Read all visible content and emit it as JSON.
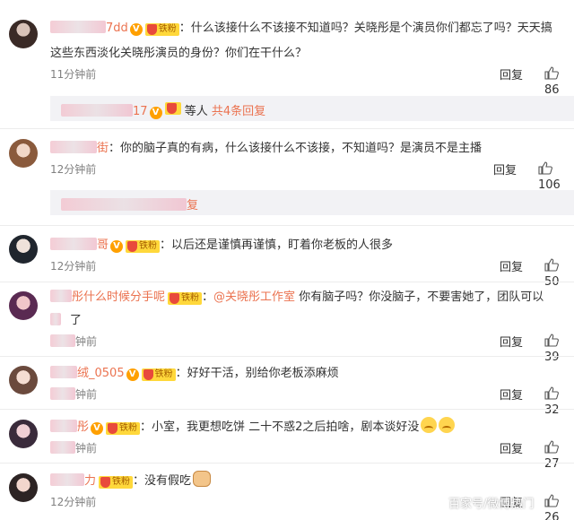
{
  "comments": [
    {
      "username_suffix": "7dd",
      "badge_fan": "铁粉",
      "text_line1": "：什么该接什么不该接不知道吗？关晓彤是个演员你们都忘了吗？天天搞",
      "text_line2": "这些东西淡化关晓彤演员的身份？你们在干什么？",
      "time": "11分钟前",
      "reply": "回复",
      "likes": "86",
      "sub_thread": {
        "user_suffix": "17",
        "label": "等人",
        "more": "共4条回复"
      }
    },
    {
      "username_suffix": "街",
      "text": "：你的脑子真的有病，什么该接什么不该接，不知道吗？是演员不是主播",
      "time": "12分钟前",
      "reply": "回复",
      "likes": "106",
      "sub_thread": {
        "tail": "复"
      }
    },
    {
      "username_suffix": "哥",
      "badge_fan": "铁粉",
      "text": "：以后还是谨慎再谨慎，盯着你老板的人很多",
      "time": "12分钟前",
      "reply": "回复",
      "likes": "50"
    },
    {
      "username_suffix": "彤什么时候分手呢",
      "badge_fan": "铁粉",
      "mention": "@关晓彤工作室",
      "text_line1": "你有脑子吗？你没脑子，不要害她了，团队可以",
      "text_line2": "了",
      "time": "钟前",
      "reply": "回复",
      "likes": "39"
    },
    {
      "username_suffix": "绒_0505",
      "badge_fan": "铁粉",
      "text": "：好好干活，别给你老板添麻烦",
      "time": "钟前",
      "reply": "回复",
      "likes": "32"
    },
    {
      "username_suffix": "彤",
      "badge_fan": "铁粉",
      "text": "：小室，我更想吃饼 二十不惑2之后拍啥，剧本谈好没",
      "time": "钟前",
      "reply": "回复",
      "likes": "27"
    },
    {
      "username_suffix": "力",
      "badge_fan": "铁粉",
      "text": "：没有假吃",
      "time": "12分钟前",
      "reply": "回复",
      "likes": "26"
    }
  ],
  "watermark": "百家号/微博热门",
  "colors": {
    "username": "#eb7350",
    "badge_v": "#ffa000",
    "badge_fan": "#ffd83b",
    "subthread_bg": "#f2f2f5"
  }
}
